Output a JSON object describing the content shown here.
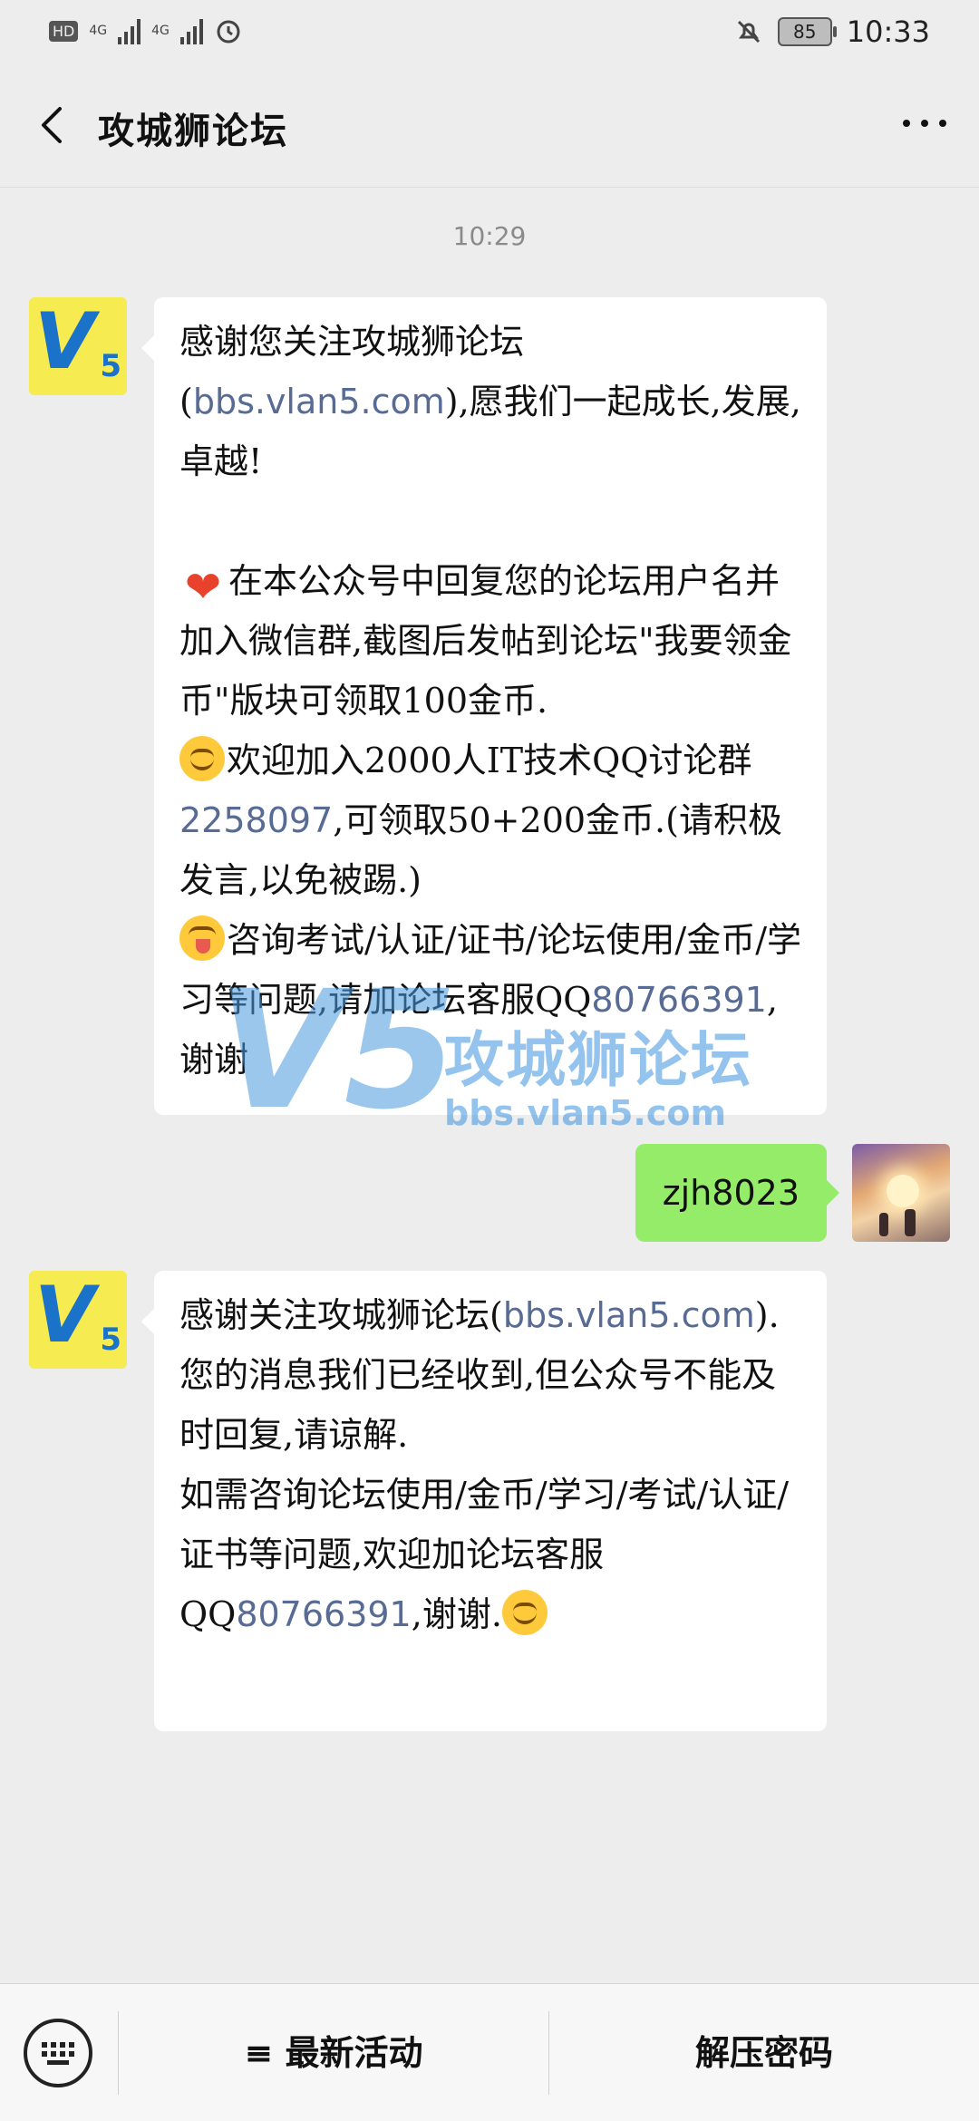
{
  "status_bar": {
    "left_indicators": [
      "HD",
      "4G",
      "4G"
    ],
    "battery": "85",
    "time": "10:33"
  },
  "header": {
    "title": "攻城狮论坛",
    "back_icon": "chevron-left-icon",
    "more_icon": "more-dots-icon"
  },
  "conversation": {
    "time_label": "10:29",
    "messages": [
      {
        "from": "official",
        "avatar_text": "V5",
        "p1_a": "感谢您关注攻城狮论坛(",
        "p1_link": "bbs.vlan5.com",
        "p1_b": "),愿我们一起成长,发展,卓越!",
        "p2": "在本公众号中回复您的论坛用户名并加入微信群,截图后发帖到论坛\"我要领金币\"版块可领取100金币.",
        "p3_a": "欢迎加入2000人IT技术QQ讨论群",
        "p3_link": "2258097",
        "p3_b": ",可领取50+200金币.(请积极发言,以免被踢.)",
        "p4_a": "咨询考试/认证/证书/论坛使用/金币/学习等问题,请加论坛客服QQ",
        "p4_link": "80766391",
        "p4_b": ",谢谢"
      },
      {
        "from": "me",
        "text": "zjh8023"
      },
      {
        "from": "official",
        "avatar_text": "V5",
        "p1_a": "感谢关注攻城狮论坛(",
        "p1_link": "bbs.vlan5.com",
        "p1_b": ").",
        "p2": "您的消息我们已经收到,但公众号不能及时回复,请谅解.",
        "p3_a": "如需咨询论坛使用/金币/学习/考试/认证/证书等问题,欢迎加论坛客服QQ",
        "p3_link": "80766391",
        "p3_b": ",谢谢."
      }
    ]
  },
  "watermark": {
    "logo": "V5",
    "name": "攻城狮论坛",
    "url": "bbs.vlan5.com"
  },
  "bottom_menu": {
    "keyboard_icon": "keyboard-icon",
    "item1": "≡ 最新活动",
    "item2": "解压密码"
  }
}
